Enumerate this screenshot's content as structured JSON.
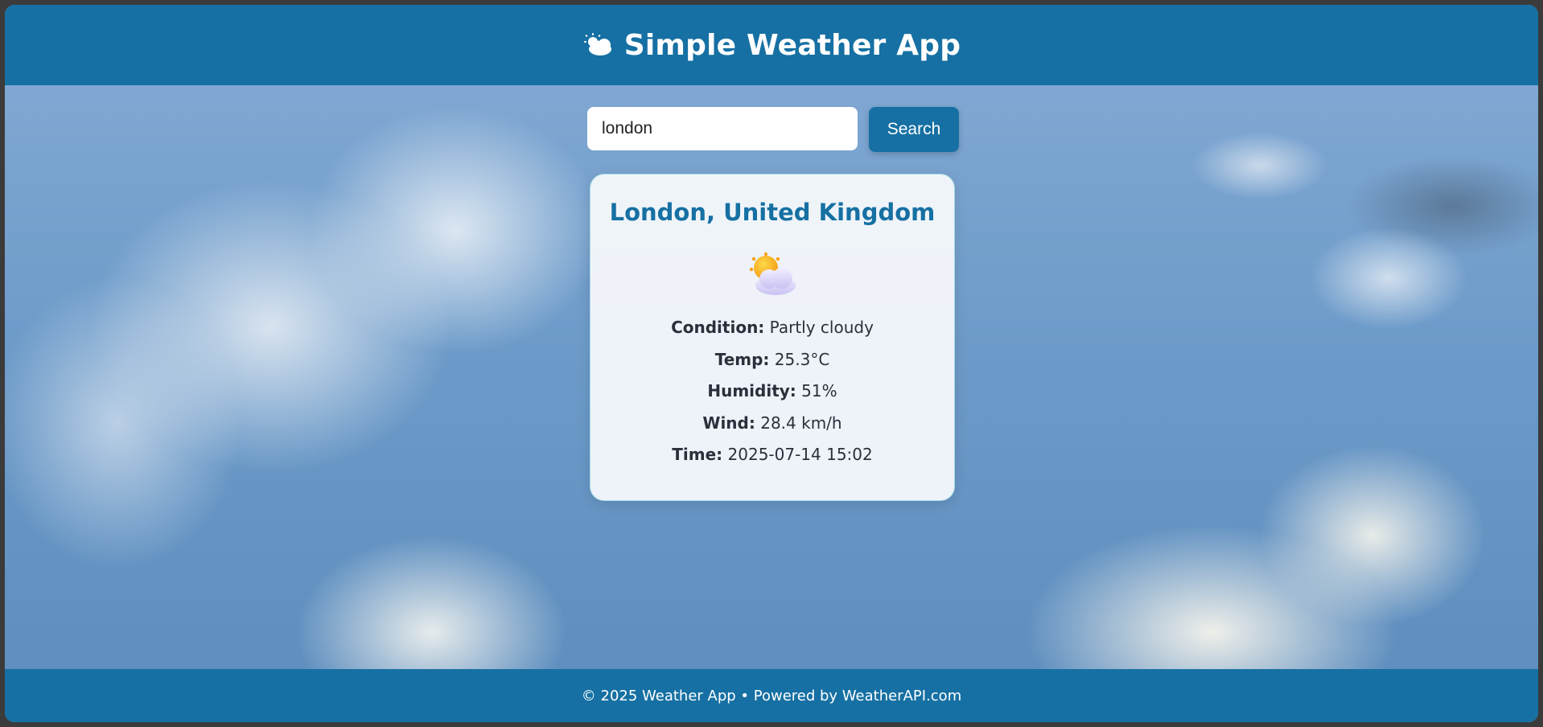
{
  "header": {
    "title": "Simple Weather App",
    "icon": "sun-behind-cloud-icon"
  },
  "search": {
    "value": "london",
    "placeholder": "",
    "button_label": "Search",
    "icon": "search-icon"
  },
  "weather": {
    "location": "London, United Kingdom",
    "icon": "partly-cloudy-icon",
    "rows": [
      {
        "label": "Condition:",
        "value": "Partly cloudy"
      },
      {
        "label": "Temp:",
        "value": "25.3°C"
      },
      {
        "label": "Humidity:",
        "value": "51%"
      },
      {
        "label": "Wind:",
        "value": "28.4 km/h"
      },
      {
        "label": "Time:",
        "value": "2025-07-14 15:02"
      }
    ]
  },
  "footer": {
    "text": "© 2025 Weather App • Powered by WeatherAPI.com"
  },
  "colors": {
    "brand": "#1670a3",
    "text_dark": "#2c2f3b",
    "card_bg": "#f6f9fc"
  }
}
